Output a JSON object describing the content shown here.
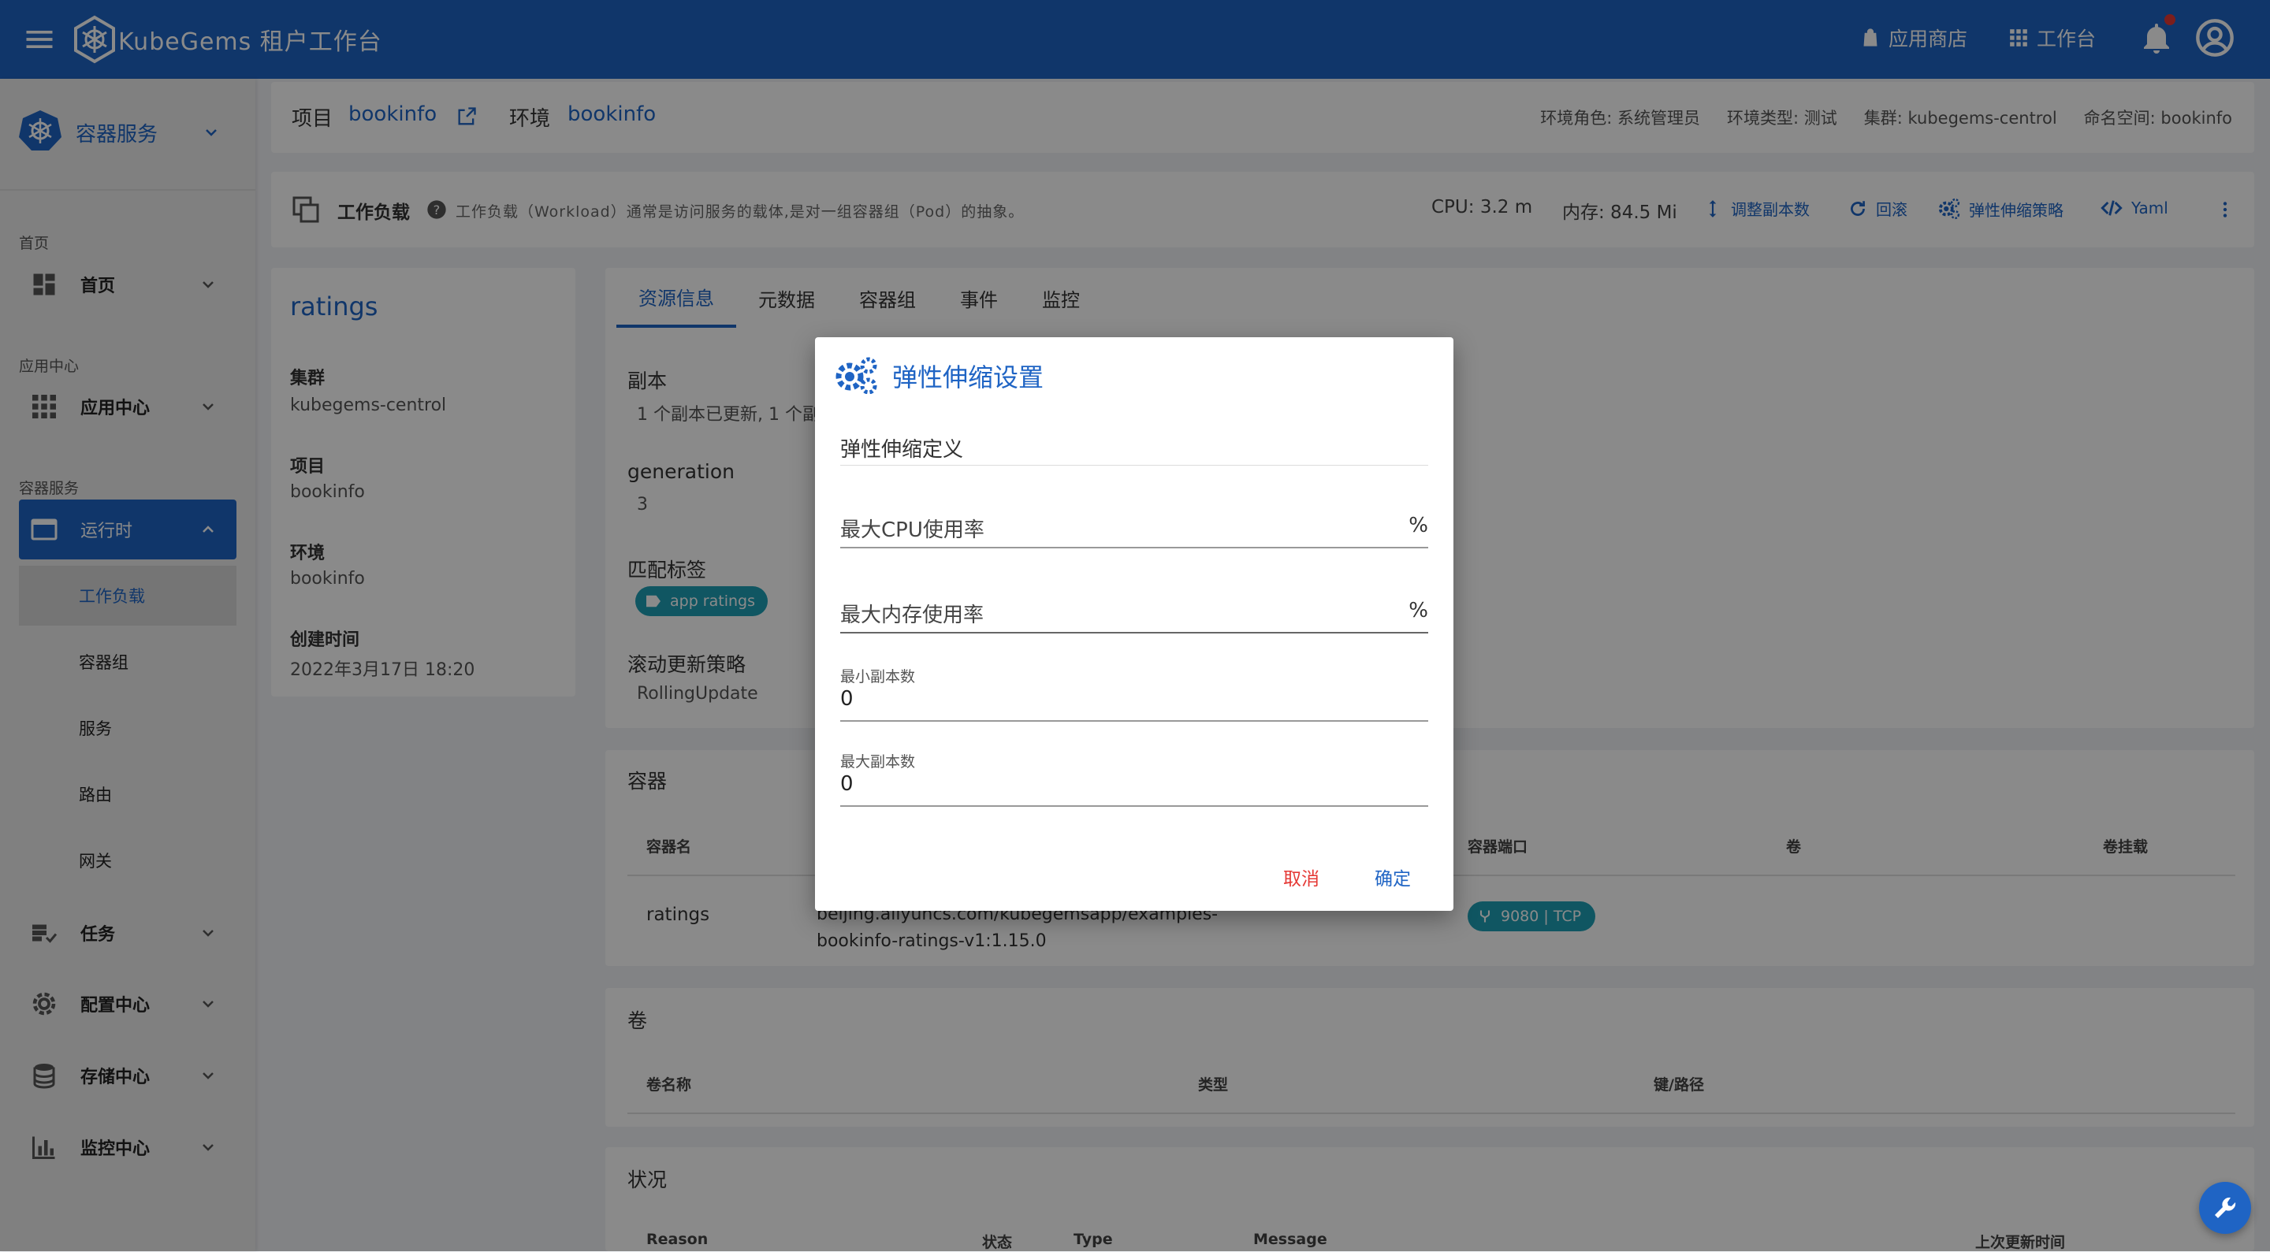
{
  "appbar": {
    "title": "KubeGems 租户工作台",
    "app_store": "应用商店",
    "workspace": "工作台"
  },
  "sidebar": {
    "header": "容器服务",
    "sections": {
      "home": "首页",
      "app_center": "应用中心",
      "container": "容器服务"
    },
    "items": {
      "home": "首页",
      "app_center": "应用中心",
      "runtime": "运行时",
      "workload": "工作负载",
      "pods": "容器组",
      "service": "服务",
      "route": "路由",
      "gateway": "网关",
      "tasks": "任务",
      "config": "配置中心",
      "storage": "存储中心",
      "monitor": "监控中心"
    }
  },
  "topbar": {
    "project_label": "项目",
    "project_value": "bookinfo",
    "env_label": "环境",
    "env_value": "bookinfo",
    "env_role": "环境角色: 系统管理员",
    "env_type": "环境类型: 测试",
    "cluster": "集群: kubegems-centrol",
    "namespace": "命名空间: bookinfo"
  },
  "toolbar": {
    "title": "工作负载",
    "hint": "工作负载（Workload）通常是访问服务的载体,是对一组容器组（Pod）的抽象。",
    "cpu": "CPU: 3.2 m",
    "mem": "内存: 84.5 Mi",
    "scale": "调整副本数",
    "rollback": "回滚",
    "hpa": "弹性伸缩策略",
    "yaml": "Yaml"
  },
  "info": {
    "name": "ratings",
    "cluster_label": "集群",
    "cluster_value": "kubegems-centrol",
    "project_label": "项目",
    "project_value": "bookinfo",
    "env_label": "环境",
    "env_value": "bookinfo",
    "created_label": "创建时间",
    "created_value": "2022年3月17日 18:20"
  },
  "tabs": [
    "资源信息",
    "元数据",
    "容器组",
    "事件",
    "监控"
  ],
  "resource": {
    "replicas_label": "副本",
    "replicas_value": "1 个副本已更新, 1 个副",
    "generation_label": "generation",
    "generation_value": "3",
    "selector_label": "匹配标签",
    "selector_chip": "app ratings",
    "strategy_label": "滚动更新策略",
    "strategy_value": "RollingUpdate"
  },
  "containers": {
    "title": "容器",
    "headers": {
      "name": "容器名",
      "port": "容器端口",
      "volume": "卷",
      "mount": "卷挂载"
    },
    "row": {
      "name": "ratings",
      "image_line1": "beijing.aliyuncs.com/kubegemsapp/examples-",
      "image_line2": "bookinfo-ratings-v1:1.15.0",
      "port": "9080 | TCP"
    }
  },
  "volumes": {
    "title": "卷",
    "headers": {
      "name": "卷名称",
      "type": "类型",
      "key": "键/路径"
    }
  },
  "conditions": {
    "title": "状况",
    "headers": {
      "reason": "Reason",
      "status": "状态",
      "type": "Type",
      "message": "Message",
      "updated": "上次更新时间"
    }
  },
  "dialog": {
    "title": "弹性伸缩设置",
    "def_label": "弹性伸缩定义",
    "cpu_label": "最大CPU使用率",
    "cpu_unit": "%",
    "mem_label": "最大内存使用率",
    "mem_unit": "%",
    "min_label": "最小副本数",
    "min_value": "0",
    "max_label": "最大副本数",
    "max_value": "0",
    "cancel": "取消",
    "confirm": "确定"
  },
  "colors": {
    "primary": "#1f64c4",
    "danger": "#e53935",
    "chip": "#1fa0b6"
  }
}
